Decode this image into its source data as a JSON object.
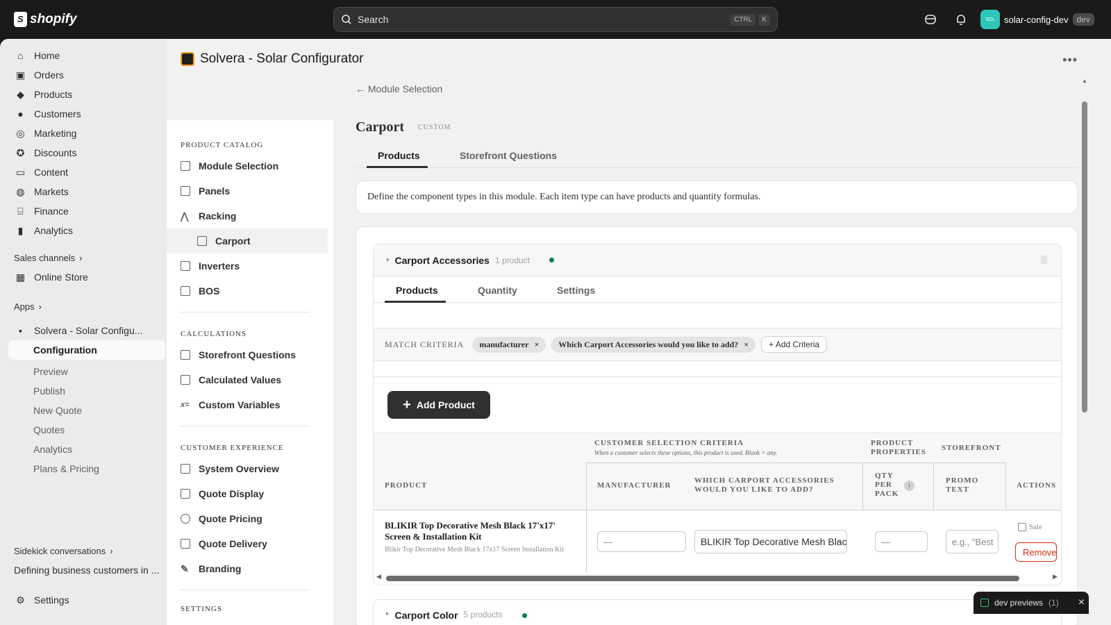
{
  "topbar": {
    "logo_text": "shopify",
    "search_placeholder": "Search",
    "kbd_ctrl": "CTRL",
    "kbd_k": "K",
    "store_avatar_text": "SOL",
    "store_name": "solar-config-dev",
    "store_badge": "dev"
  },
  "sidebar": {
    "items": [
      {
        "label": "Home",
        "icon": "home-icon"
      },
      {
        "label": "Orders",
        "icon": "orders-icon"
      },
      {
        "label": "Products",
        "icon": "tag-icon"
      },
      {
        "label": "Customers",
        "icon": "person-icon"
      },
      {
        "label": "Marketing",
        "icon": "target-icon"
      },
      {
        "label": "Discounts",
        "icon": "discount-icon"
      },
      {
        "label": "Content",
        "icon": "monitor-icon"
      },
      {
        "label": "Markets",
        "icon": "globe-icon"
      },
      {
        "label": "Finance",
        "icon": "bank-icon"
      },
      {
        "label": "Analytics",
        "icon": "bar-chart-icon"
      }
    ],
    "sales_channels": "Sales channels",
    "online_store": "Online Store",
    "apps": "Apps",
    "app_name": "Solvera - Solar Configu...",
    "app_subs": [
      "Configuration",
      "Preview",
      "Publish",
      "New Quote",
      "Quotes",
      "Analytics",
      "Plans & Pricing"
    ],
    "sidekick": "Sidekick conversations",
    "sidekick_item": "Defining business customers in ...",
    "settings": "Settings"
  },
  "app_header": {
    "title": "Solvera - Solar Configurator"
  },
  "inner_nav": {
    "sections": [
      {
        "title": "PRODUCT CATALOG",
        "items": [
          "Module Selection",
          "Panels",
          "Racking",
          "Carport",
          "Inverters",
          "BOS"
        ]
      },
      {
        "title": "CALCULATIONS",
        "items": [
          "Storefront Questions",
          "Calculated Values",
          "Custom Variables"
        ]
      },
      {
        "title": "CUSTOMER EXPERIENCE",
        "items": [
          "System Overview",
          "Quote Display",
          "Quote Pricing",
          "Quote Delivery",
          "Branding"
        ]
      },
      {
        "title": "SETTINGS",
        "items": []
      }
    ]
  },
  "page": {
    "back_link": "← Module Selection",
    "title": "Carport",
    "tag": "CUSTOM",
    "tabs": [
      "Products",
      "Storefront Questions"
    ],
    "description": "Define the component types in this module. Each item type can have products and quantity formulas."
  },
  "accordion": {
    "title": "Carport Accessories",
    "count": "1 product",
    "status_color": "#007f5f",
    "sub_tabs": [
      "Products",
      "Quantity",
      "Settings"
    ],
    "criteria_label": "MATCH CRITERIA",
    "chips": [
      "manufacturer",
      "Which Carport Accessories would you like to add?"
    ],
    "add_criteria": "+ Add Criteria",
    "add_product": "Add Product",
    "table": {
      "group_customer": "CUSTOMER SELECTION CRITERIA",
      "group_customer_note": "When a customer selects these options, this product is used. Blank = any.",
      "group_props": "PRODUCT PROPERTIES",
      "group_storefront": "STOREFRONT",
      "col_product": "PRODUCT",
      "col_manufacturer": "MANUFACTURER",
      "col_accessories": "WHICH CARPORT ACCESSORIES WOULD YOU LIKE TO ADD?",
      "col_qty": "QTY PER PACK",
      "col_promo": "PROMO TEXT",
      "col_actions": "ACTIONS",
      "row": {
        "name": "BLIKIR Top Decorative Mesh Black 17'x17' Screen & Installation Kit",
        "sub": "Blikir Top Decorative Mesh Black 17x17 Screen Installation Kit",
        "manufacturer_placeholder": "—",
        "accessory_value": "BLIKIR Top Decorative Mesh Black",
        "qty_placeholder": "—",
        "promo_placeholder": "e.g., \"Best",
        "sale_label": "Sale",
        "remove_label": "Remove"
      }
    }
  },
  "accordion2": {
    "title": "Carport Color",
    "count": "5 products",
    "status_color": "#007f5f"
  },
  "dev_previews": {
    "label": "dev previews",
    "count": "(1)"
  }
}
